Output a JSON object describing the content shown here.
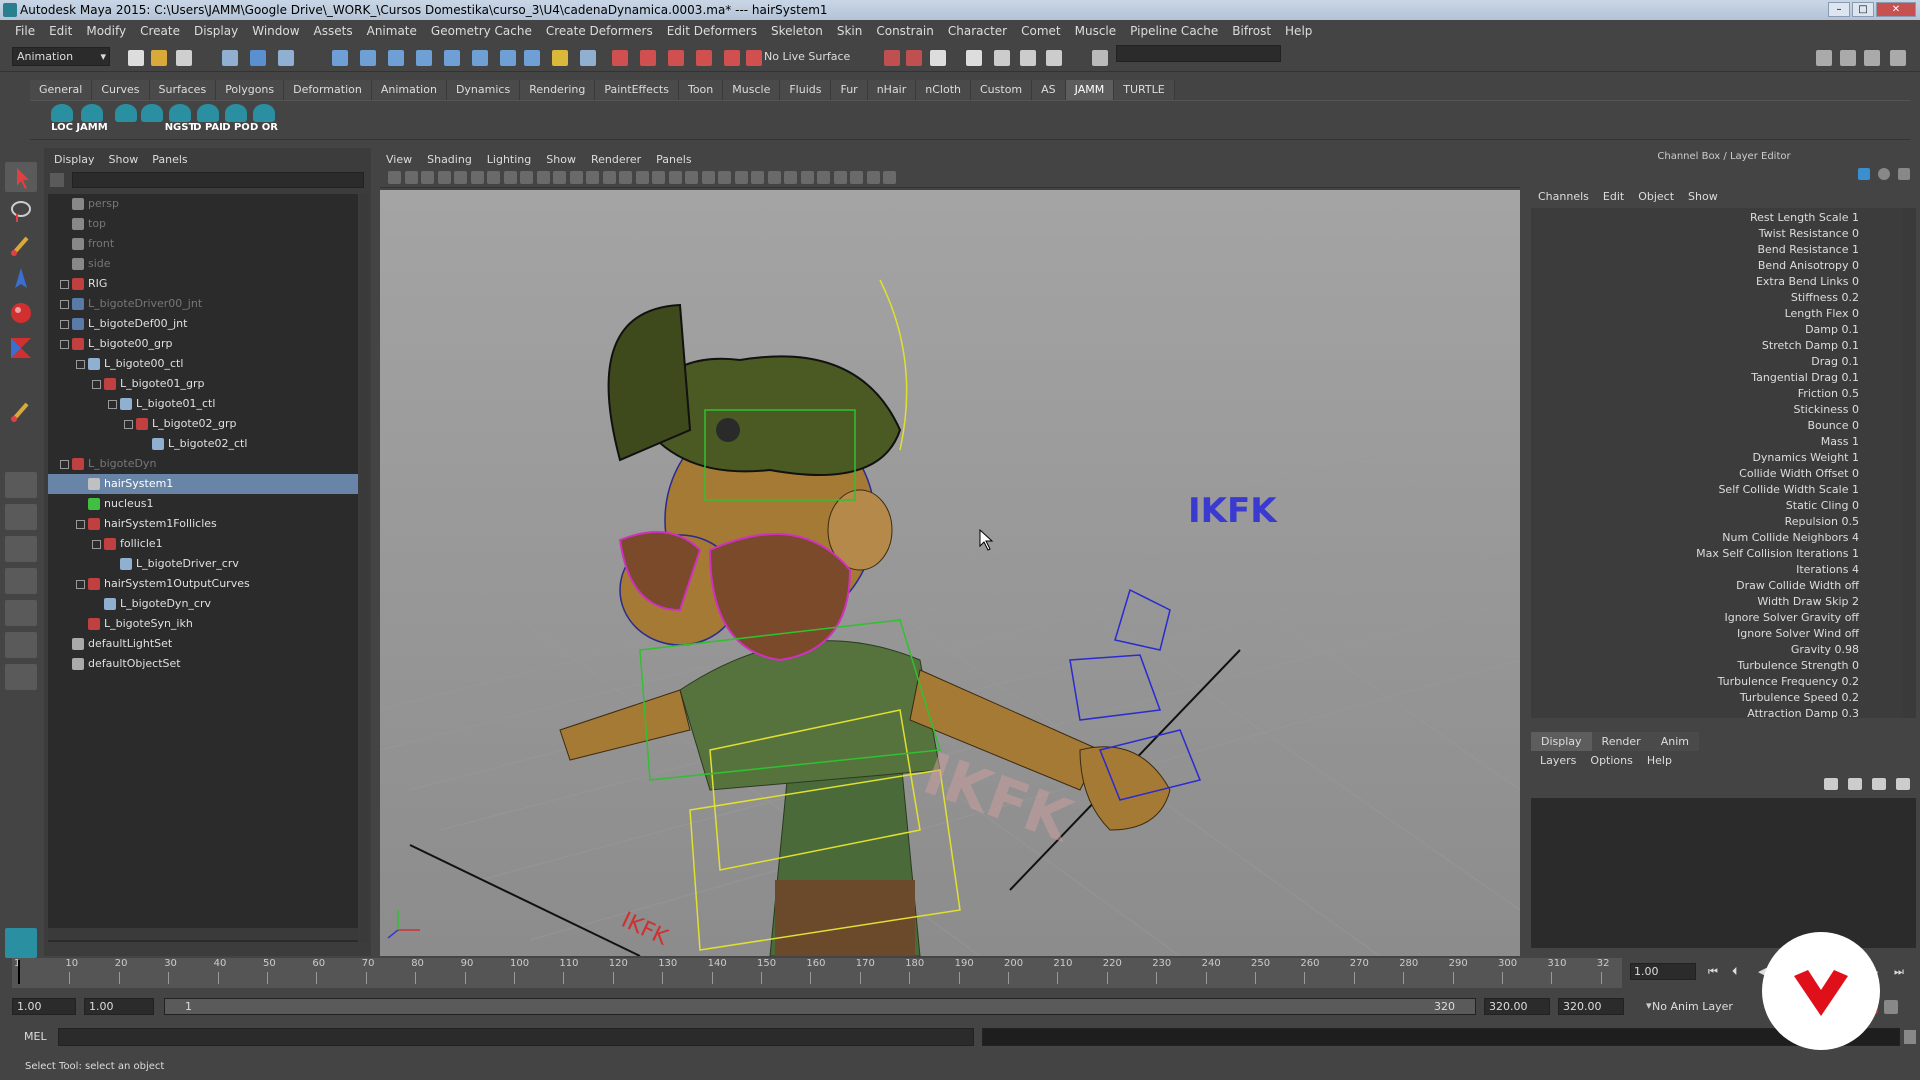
{
  "window": {
    "title": "Autodesk Maya 2015: C:\\Users\\JAMM\\Google Drive\\_WORK_\\Cursos Domestika\\curso_3\\U4\\cadenaDynamica.0003.ma*   ---   hairSystem1"
  },
  "menubar": [
    "File",
    "Edit",
    "Modify",
    "Create",
    "Display",
    "Window",
    "Assets",
    "Animate",
    "Geometry Cache",
    "Create Deformers",
    "Edit Deformers",
    "Skeleton",
    "Skin",
    "Constrain",
    "Character",
    "Comet",
    "Muscle",
    "Pipeline Cache",
    "Bifrost",
    "Help"
  ],
  "statusline": {
    "mode": "Animation",
    "live_surface": "No Live Surface"
  },
  "shelf": {
    "tabs": [
      "General",
      "Curves",
      "Surfaces",
      "Polygons",
      "Deformation",
      "Animation",
      "Dynamics",
      "Rendering",
      "PaintEffects",
      "Toon",
      "Muscle",
      "Fluids",
      "Fur",
      "nHair",
      "nCloth",
      "Custom",
      "AS",
      "JAMM",
      "TURTLE"
    ],
    "active_tab": "JAMM",
    "buttons": [
      "LOC",
      "JAMM",
      "",
      "",
      "NGST",
      "D PAI",
      "D PO",
      "D OR"
    ]
  },
  "outliner": {
    "menu": [
      "Display",
      "Show",
      "Panels"
    ],
    "rows": [
      {
        "label": "persp",
        "dim": true
      },
      {
        "label": "top",
        "dim": true
      },
      {
        "label": "front",
        "dim": true
      },
      {
        "label": "side",
        "dim": true
      },
      {
        "label": "RIG"
      },
      {
        "label": "L_bigoteDriver00_jnt",
        "dim": true
      },
      {
        "label": "L_bigoteDef00_jnt"
      },
      {
        "label": "L_bigote00_grp"
      },
      {
        "label": "L_bigote00_ctl"
      },
      {
        "label": "L_bigote01_grp"
      },
      {
        "label": "L_bigote01_ctl"
      },
      {
        "label": "L_bigote02_grp"
      },
      {
        "label": "L_bigote02_ctl"
      },
      {
        "label": "L_bigoteDyn",
        "dim": true
      },
      {
        "label": "hairSystem1",
        "selected": true
      },
      {
        "label": "nucleus1"
      },
      {
        "label": "hairSystem1Follicles"
      },
      {
        "label": "follicle1"
      },
      {
        "label": "L_bigoteDriver_crv"
      },
      {
        "label": "hairSystem1OutputCurves"
      },
      {
        "label": "L_bigoteDyn_crv"
      },
      {
        "label": "L_bigoteSyn_ikh"
      },
      {
        "label": "defaultLightSet"
      },
      {
        "label": "defaultObjectSet"
      }
    ]
  },
  "viewport": {
    "menu": [
      "View",
      "Shading",
      "Lighting",
      "Show",
      "Renderer",
      "Panels"
    ],
    "scene_labels": [
      "IKFK",
      "IKFK",
      "IKFK"
    ]
  },
  "channelbox": {
    "title": "Channel Box / Layer Editor",
    "menu": [
      "Channels",
      "Edit",
      "Object",
      "Show"
    ],
    "attributes": [
      {
        "name": "Rest Length Scale",
        "value": "1"
      },
      {
        "name": "Twist Resistance",
        "value": "0"
      },
      {
        "name": "Bend Resistance",
        "value": "1"
      },
      {
        "name": "Bend Anisotropy",
        "value": "0"
      },
      {
        "name": "Extra Bend Links",
        "value": "0"
      },
      {
        "name": "Stiffness",
        "value": "0.2"
      },
      {
        "name": "Length Flex",
        "value": "0"
      },
      {
        "name": "Damp",
        "value": "0.1"
      },
      {
        "name": "Stretch Damp",
        "value": "0.1"
      },
      {
        "name": "Drag",
        "value": "0.1"
      },
      {
        "name": "Tangential Drag",
        "value": "0.1"
      },
      {
        "name": "Friction",
        "value": "0.5"
      },
      {
        "name": "Stickiness",
        "value": "0"
      },
      {
        "name": "Bounce",
        "value": "0"
      },
      {
        "name": "Mass",
        "value": "1"
      },
      {
        "name": "Dynamics Weight",
        "value": "1"
      },
      {
        "name": "Collide Width Offset",
        "value": "0"
      },
      {
        "name": "Self Collide Width Scale",
        "value": "1"
      },
      {
        "name": "Static Cling",
        "value": "0"
      },
      {
        "name": "Repulsion",
        "value": "0.5"
      },
      {
        "name": "Num Collide Neighbors",
        "value": "4"
      },
      {
        "name": "Max Self Collision Iterations",
        "value": "1"
      },
      {
        "name": "Iterations",
        "value": "4"
      },
      {
        "name": "Draw Collide Width",
        "value": "off"
      },
      {
        "name": "Width Draw Skip",
        "value": "2"
      },
      {
        "name": "Ignore Solver Gravity",
        "value": "off"
      },
      {
        "name": "Ignore Solver Wind",
        "value": "off"
      },
      {
        "name": "Gravity",
        "value": "0.98"
      },
      {
        "name": "Turbulence Strength",
        "value": "0"
      },
      {
        "name": "Turbulence Frequency",
        "value": "0.2"
      },
      {
        "name": "Turbulence Speed",
        "value": "0.2"
      },
      {
        "name": "Attraction Damp",
        "value": "0.3"
      }
    ],
    "layer_tabs": [
      "Display",
      "Render",
      "Anim"
    ],
    "layer_menu": [
      "Layers",
      "Options",
      "Help"
    ]
  },
  "timeslider": {
    "ticks": [
      "1",
      "10",
      "20",
      "30",
      "40",
      "50",
      "60",
      "70",
      "80",
      "90",
      "100",
      "110",
      "120",
      "130",
      "140",
      "150",
      "160",
      "170",
      "180",
      "190",
      "200",
      "210",
      "220",
      "230",
      "240",
      "250",
      "260",
      "270",
      "280",
      "290",
      "300",
      "310",
      "32"
    ],
    "current_frame": "1.00"
  },
  "range": {
    "start": "1.00",
    "anim_start": "1.00",
    "range_start": "1",
    "range_end": "320",
    "anim_end": "320.00",
    "end": "320.00",
    "anim_layer": "No Anim Layer"
  },
  "cmdline": {
    "label": "MEL"
  },
  "helpline": {
    "text": "Select Tool: select an object"
  }
}
